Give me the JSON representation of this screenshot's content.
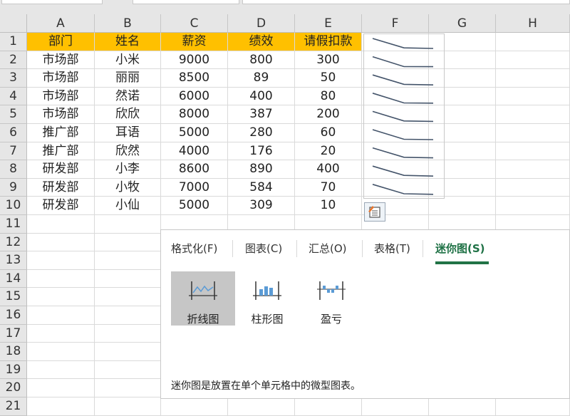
{
  "columns": [
    "A",
    "B",
    "C",
    "D",
    "E",
    "F",
    "G",
    "H"
  ],
  "rows": [
    "1",
    "2",
    "3",
    "4",
    "5",
    "6",
    "7",
    "8",
    "9",
    "10",
    "11",
    "12",
    "13",
    "14",
    "15",
    "16",
    "17",
    "18",
    "19",
    "20",
    "21"
  ],
  "table": {
    "headers": [
      "部门",
      "姓名",
      "薪资",
      "绩效",
      "请假扣款"
    ],
    "data": [
      [
        "市场部",
        "小米",
        "9000",
        "800",
        "300"
      ],
      [
        "市场部",
        "丽丽",
        "8500",
        "89",
        "50"
      ],
      [
        "市场部",
        "然诺",
        "6000",
        "400",
        "80"
      ],
      [
        "市场部",
        "欣欣",
        "8000",
        "387",
        "200"
      ],
      [
        "推广部",
        "耳语",
        "5000",
        "280",
        "60"
      ],
      [
        "推广部",
        "欣然",
        "4000",
        "176",
        "20"
      ],
      [
        "研发部",
        "小李",
        "8600",
        "890",
        "400"
      ],
      [
        "研发部",
        "小牧",
        "7000",
        "584",
        "70"
      ],
      [
        "研发部",
        "小仙",
        "5000",
        "309",
        "10"
      ]
    ]
  },
  "quick_analysis": {
    "tabs": [
      "格式化(F)",
      "图表(C)",
      "汇总(O)",
      "表格(T)",
      "迷你图(S)"
    ],
    "active_tab": "迷你图(S)",
    "options": [
      "折线图",
      "柱形图",
      "盈亏"
    ],
    "selected_option": "折线图",
    "description": "迷你图是放置在单个单元格中的微型图表。"
  },
  "colors": {
    "header_fill": "#ffc000",
    "accent": "#217346",
    "sparkline": "#44546a"
  }
}
